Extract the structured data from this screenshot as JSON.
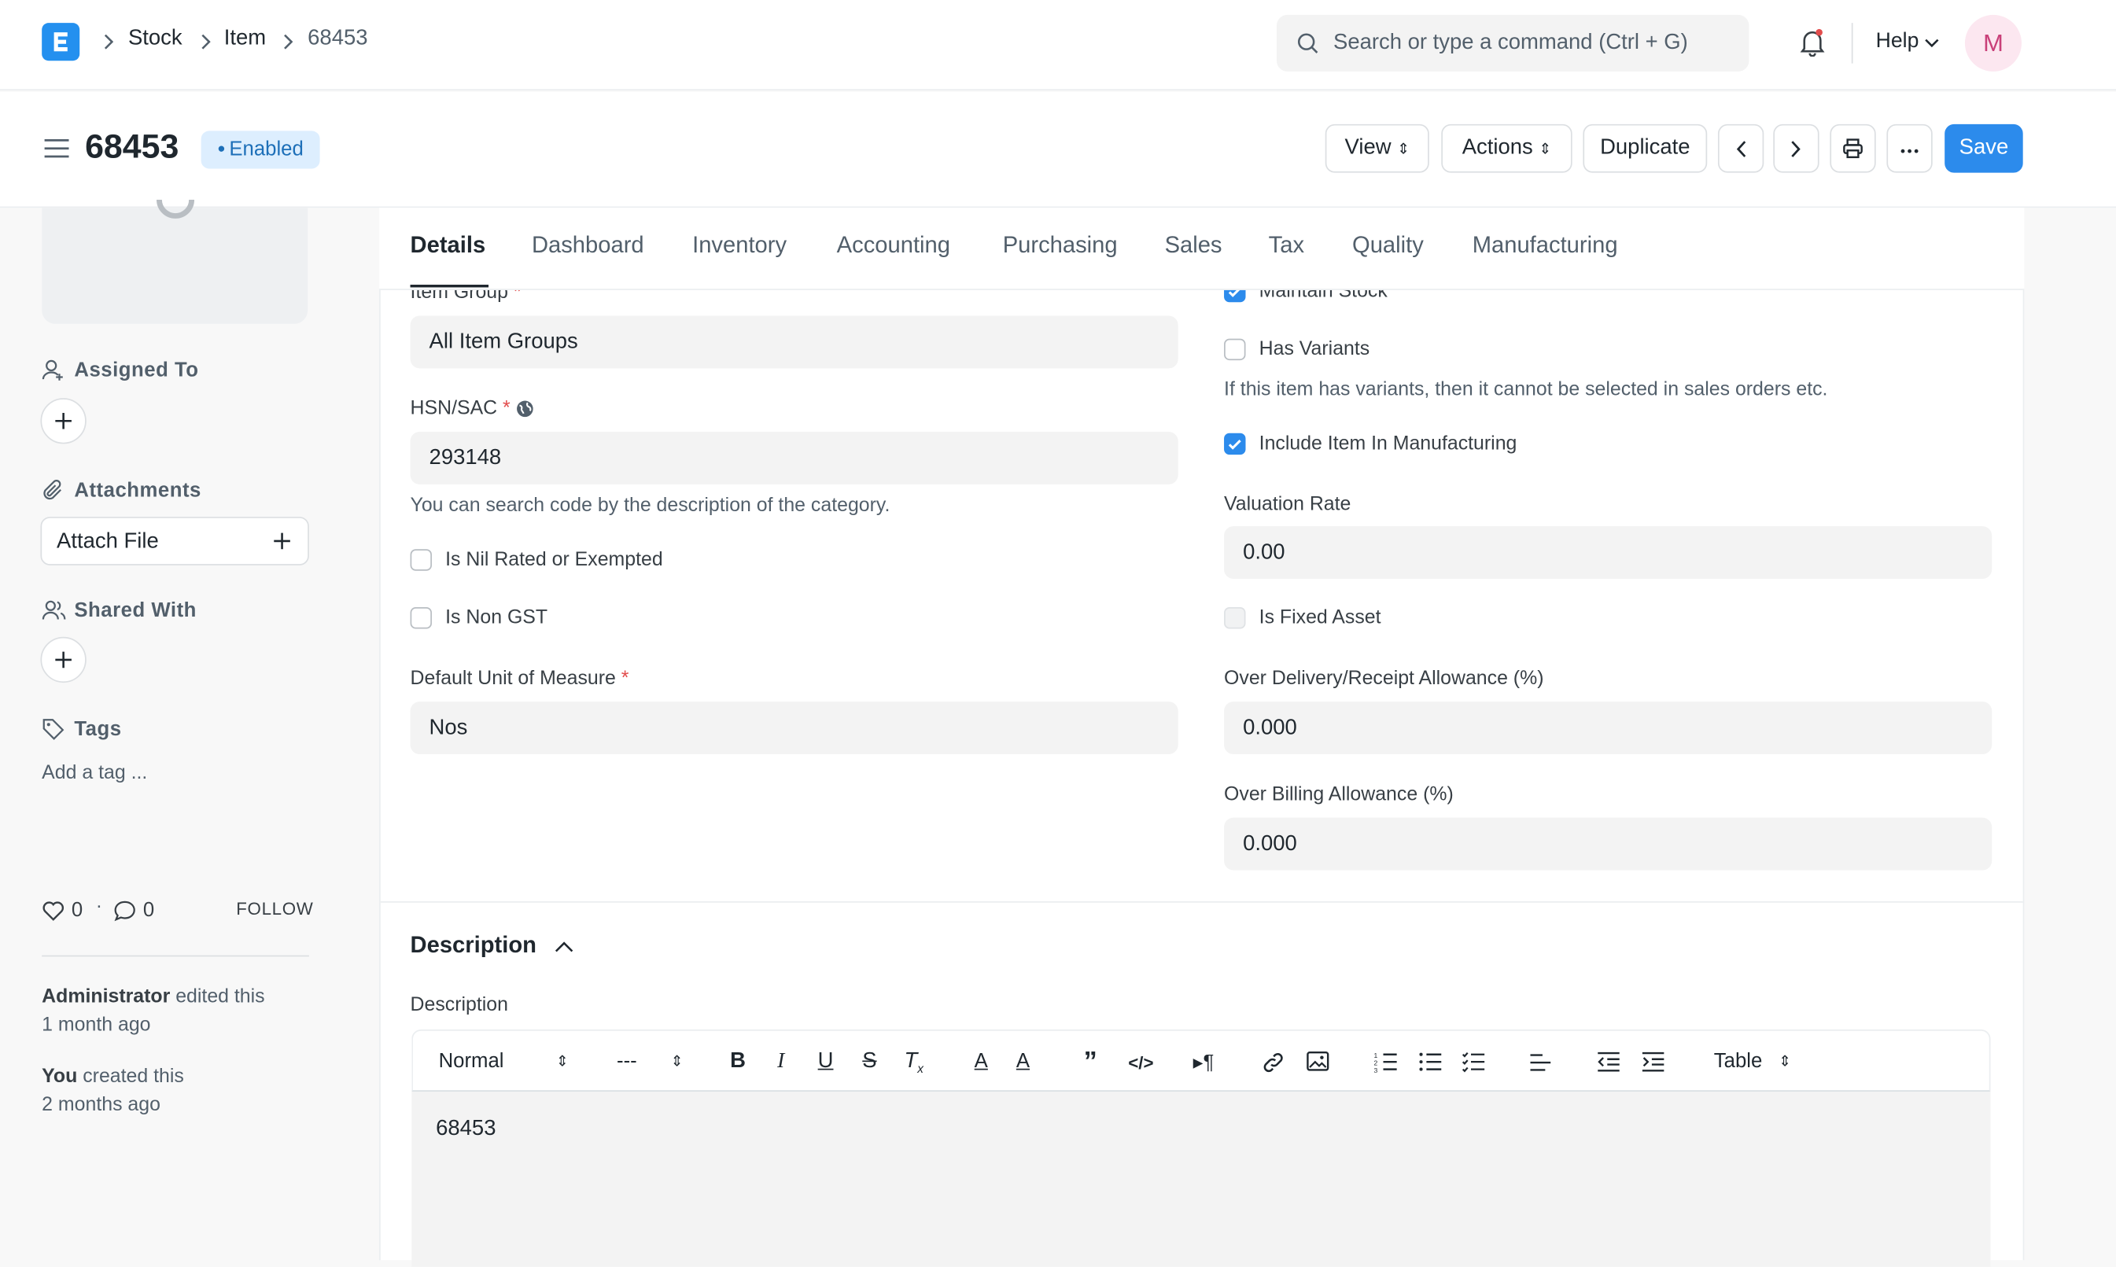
{
  "navbar": {
    "breadcrumbs": [
      "Stock",
      "Item",
      "68453"
    ],
    "search_placeholder": "Search or type a command (Ctrl + G)",
    "help_label": "Help",
    "avatar_initial": "M"
  },
  "header": {
    "title": "68453",
    "status": "Enabled",
    "buttons": {
      "view": "View",
      "actions": "Actions",
      "duplicate": "Duplicate",
      "save": "Save"
    }
  },
  "sidebar": {
    "assigned_to": "Assigned To",
    "attachments": "Attachments",
    "attach_file": "Attach File",
    "shared_with": "Shared With",
    "tags": "Tags",
    "add_tag": "Add a tag ...",
    "likes": "0",
    "comments": "0",
    "follow": "FOLLOW",
    "activity": [
      {
        "user": "Administrator",
        "action": " edited this",
        "time": "1 month ago"
      },
      {
        "user": "You",
        "action": " created this",
        "time": "2 months ago"
      }
    ]
  },
  "tabs": [
    "Details",
    "Dashboard",
    "Inventory",
    "Accounting",
    "Purchasing",
    "Sales",
    "Tax",
    "Quality",
    "Manufacturing"
  ],
  "form": {
    "item_group_label": "Item Group",
    "item_group_value": "All Item Groups",
    "hsn_label": "HSN/SAC",
    "hsn_value": "293148",
    "hsn_hint": "You can search code by the description of the category.",
    "nil_rated": "Is Nil Rated or Exempted",
    "non_gst": "Is Non GST",
    "uom_label": "Default Unit of Measure",
    "uom_value": "Nos",
    "maintain_stock": "Maintain Stock",
    "has_variants": "Has Variants",
    "variants_hint": "If this item has variants, then it cannot be selected in sales orders etc.",
    "include_manufacturing": "Include Item In Manufacturing",
    "valuation_label": "Valuation Rate",
    "valuation_value": "0.00",
    "fixed_asset": "Is Fixed Asset",
    "over_delivery_label": "Over Delivery/Receipt Allowance (%)",
    "over_delivery_value": "0.000",
    "over_billing_label": "Over Billing Allowance (%)",
    "over_billing_value": "0.000"
  },
  "description": {
    "section_title": "Description",
    "field_label": "Description",
    "format_select": "Normal",
    "size_select": "---",
    "table_select": "Table",
    "content": "68453"
  },
  "colors": {
    "primary": "#2c8bec",
    "logo": "#2490ef",
    "badge_bg": "#ddeefe",
    "required": "#e24c4c"
  }
}
